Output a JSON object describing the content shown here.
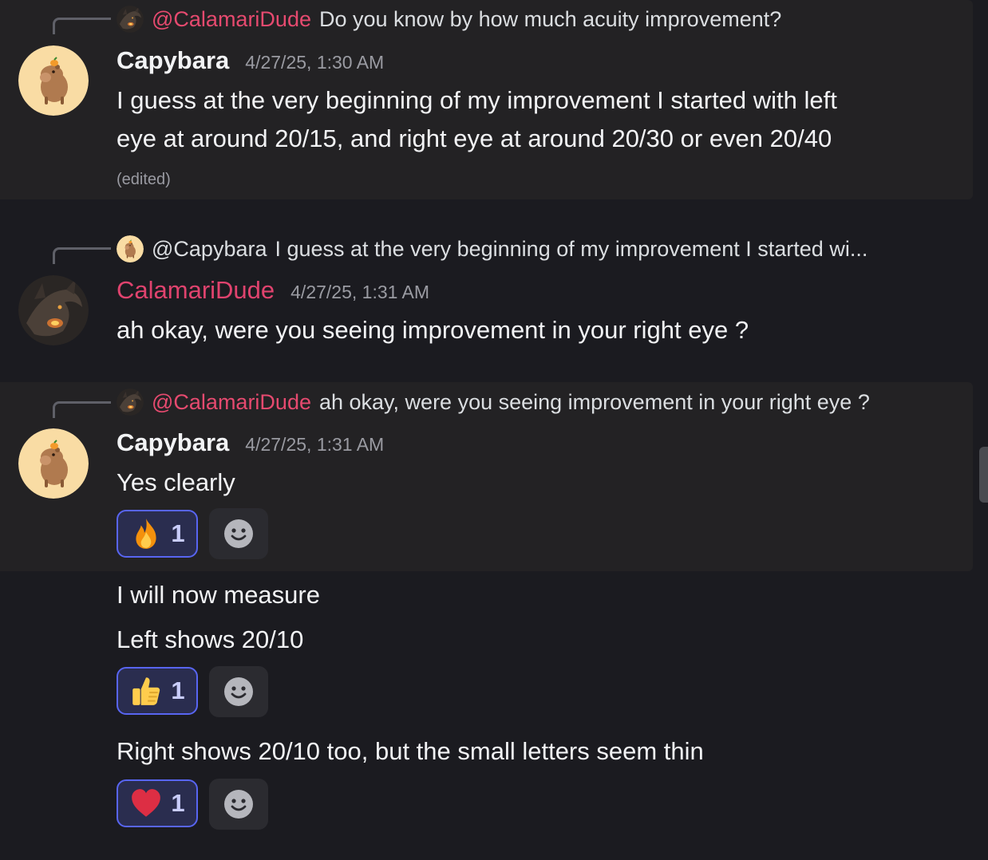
{
  "messages": [
    {
      "reply": {
        "mention": "@CalamariDude",
        "text": "Do you know by how much acuity improvement?",
        "avatar": "dragon-avatar"
      },
      "author": "Capybara",
      "timestamp": "4/27/25, 1:30 AM",
      "lines": [
        "I guess at the very beginning of my improvement I started with left",
        "eye at around 20/15, and right eye at around 20/30 or even 20/40"
      ],
      "edited": "(edited)"
    },
    {
      "reply": {
        "mention": "@Capybara",
        "text": "I guess at the very beginning of my improvement I started wi...",
        "avatar": "capybara-avatar"
      },
      "author": "CalamariDude",
      "timestamp": "4/27/25, 1:31 AM",
      "lines": [
        "ah okay, were you seeing improvement in your right eye ?"
      ]
    },
    {
      "reply": {
        "mention": "@CalamariDude",
        "text": "ah okay, were you seeing improvement in your right eye ?",
        "avatar": "dragon-avatar"
      },
      "author": "Capybara",
      "timestamp": "4/27/25, 1:31 AM",
      "lines": [
        "Yes clearly"
      ],
      "reaction": {
        "emoji": "fire-icon",
        "count": "1"
      }
    }
  ],
  "followups": [
    {
      "text": "I will now measure"
    },
    {
      "text": "Left shows 20/10",
      "reaction": {
        "emoji": "thumbs-up-icon",
        "count": "1"
      }
    },
    {
      "text": "Right shows 20/10 too, but the small letters seem thin",
      "reaction": {
        "emoji": "heart-icon",
        "count": "1"
      }
    }
  ],
  "colors": {
    "background": "#1b1b20",
    "highlight": "#232224",
    "mention_red": "#e64a6f",
    "reaction_border": "#5865f2",
    "reaction_bg": "#2a2d4f"
  }
}
